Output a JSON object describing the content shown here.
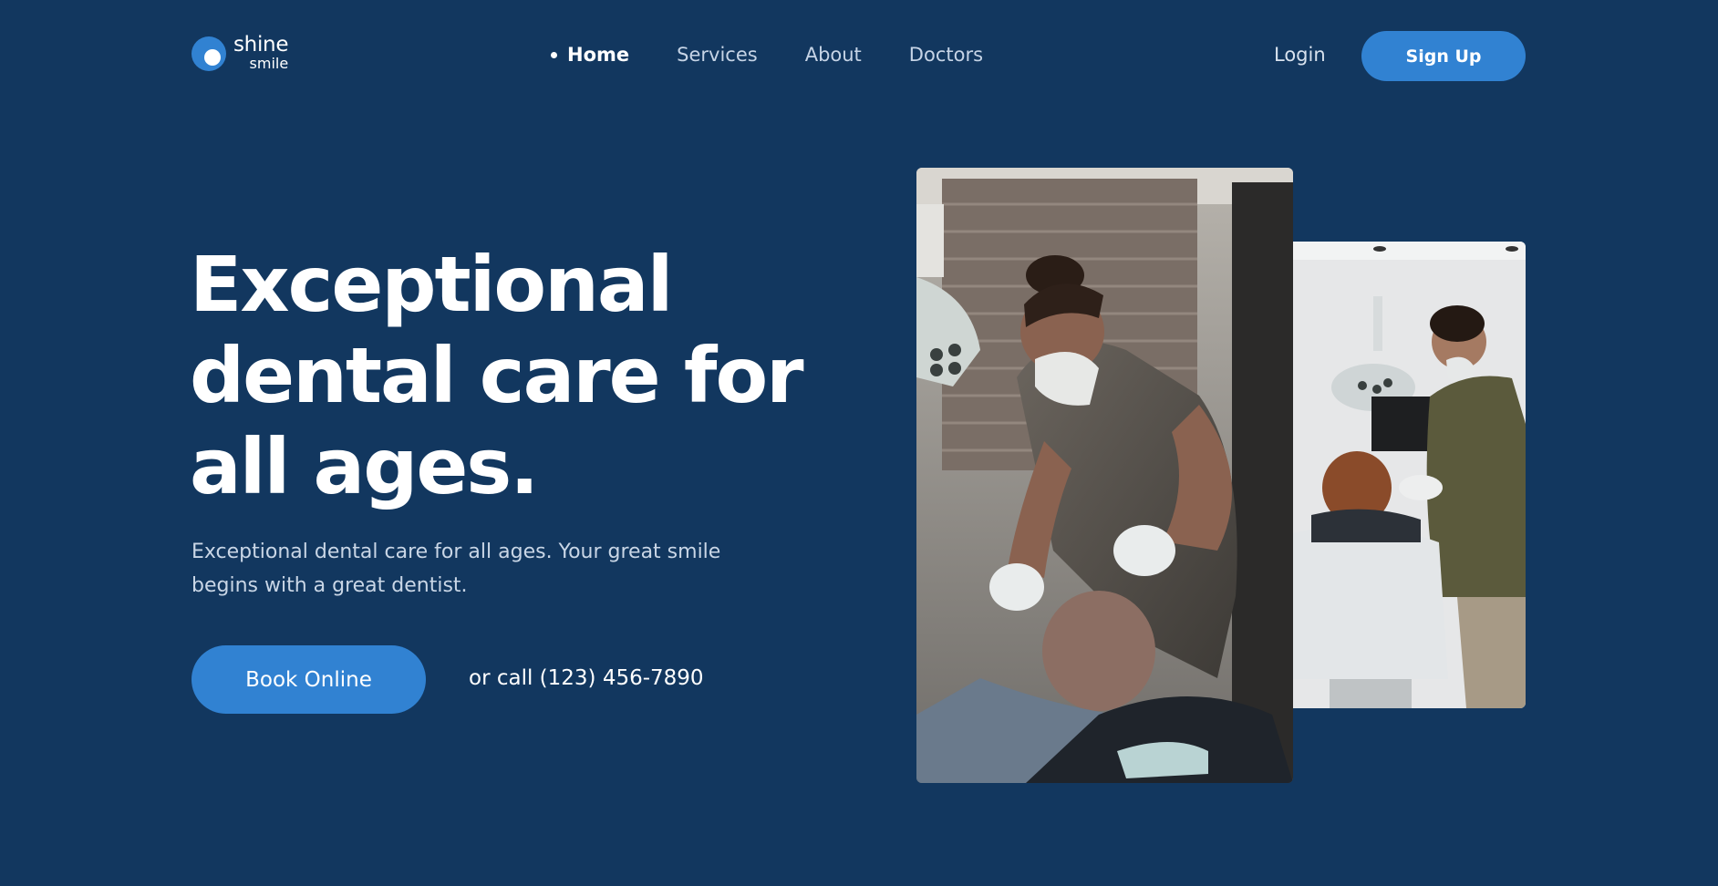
{
  "brand": {
    "word1": "shine",
    "word2": "smile",
    "accent": "#3182d2",
    "background": "#12375f"
  },
  "nav": {
    "items": [
      {
        "label": "Home",
        "active": true
      },
      {
        "label": "Services",
        "active": false
      },
      {
        "label": "About",
        "active": false
      },
      {
        "label": "Doctors",
        "active": false
      }
    ]
  },
  "auth": {
    "login_label": "Login",
    "signup_label": "Sign Up"
  },
  "hero": {
    "headline": "Exceptional dental care for all ages.",
    "subtext": "Exceptional dental care for all ages. Your great smile begins with a great dentist.",
    "book_label": "Book Online",
    "call_text": "or call (123) 456-7890"
  },
  "images": {
    "main": "dentist-with-patient-photo",
    "side": "dentist-treating-patient-photo"
  }
}
